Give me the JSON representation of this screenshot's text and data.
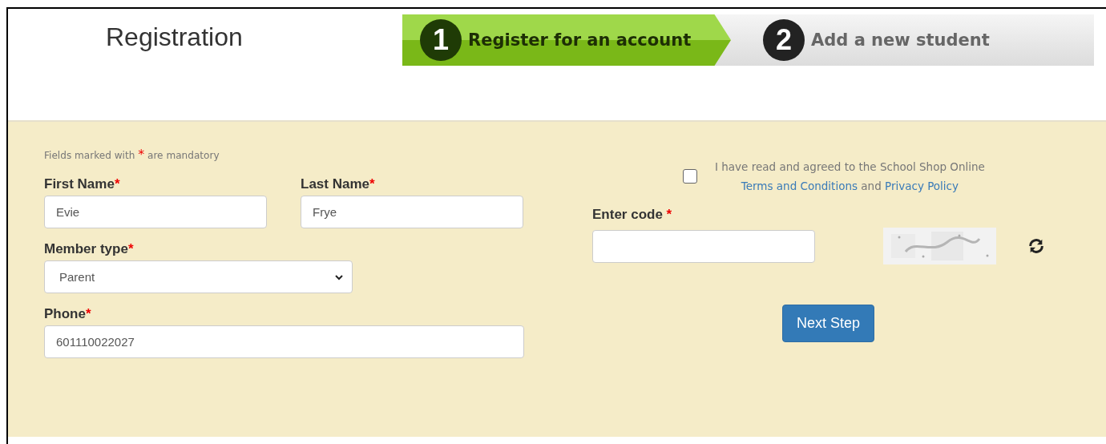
{
  "title": "Registration",
  "steps": [
    {
      "number": "1",
      "label": "Register for an account",
      "selected": true
    },
    {
      "number": "2",
      "label": "Add a new student",
      "selected": false
    }
  ],
  "mandatory_note": {
    "before": "Fields marked with",
    "mark": "*",
    "after": "are mandatory"
  },
  "fields": [
    {
      "kind": "text",
      "label": "First Name",
      "mark": "*",
      "value": "Evie"
    },
    {
      "kind": "text",
      "label": "Last Name",
      "mark": "*",
      "value": "Frye"
    },
    {
      "kind": "select",
      "label": "Member type",
      "mark": "*",
      "value": "Parent"
    },
    {
      "kind": "text",
      "label": "Phone",
      "mark": "*",
      "value": "601110022027"
    }
  ],
  "agreement": {
    "checked": false,
    "text": "I have read and agreed to the School Shop Online",
    "link_1": "Terms and Conditions",
    "joiner": "and",
    "link_2": "Privacy Policy"
  },
  "code": {
    "label": "Enter code",
    "mark": "*"
  },
  "next_button": "Next Step"
}
